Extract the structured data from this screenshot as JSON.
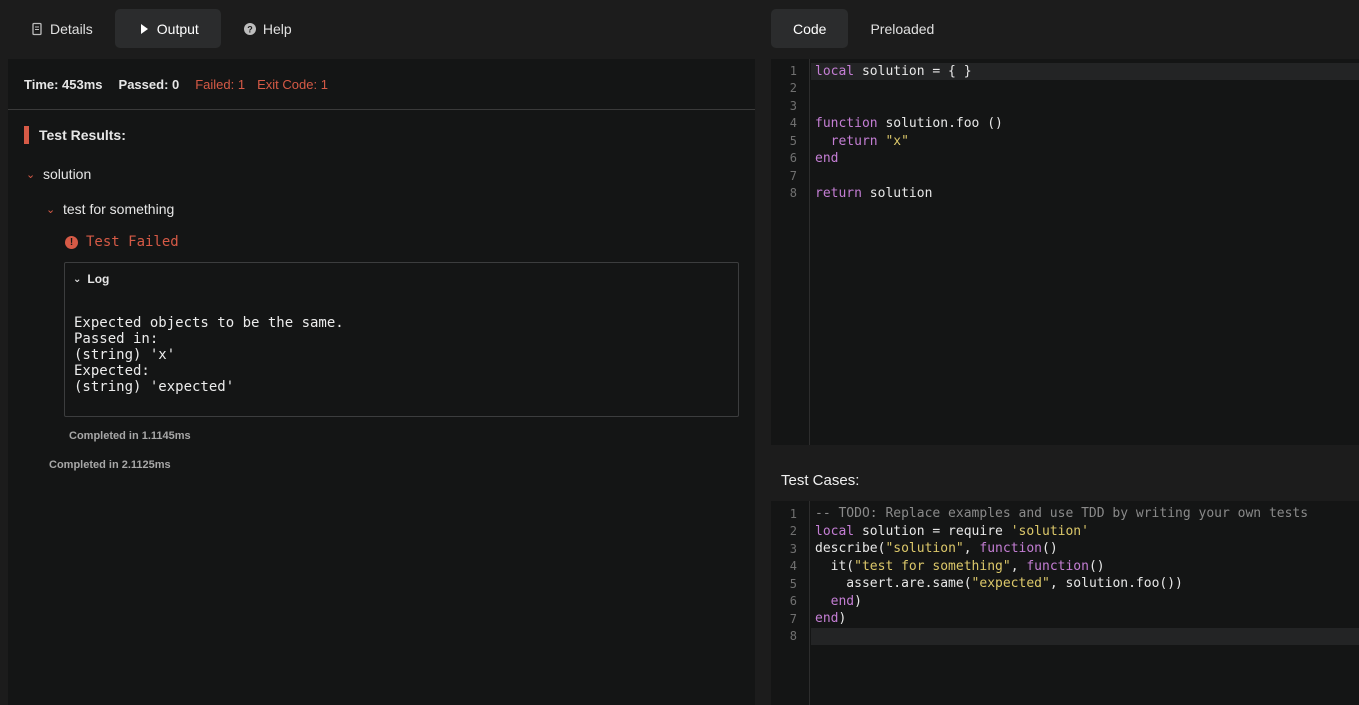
{
  "left_tabs": [
    {
      "label": "Details",
      "icon": "document-icon"
    },
    {
      "label": "Output",
      "icon": "play-icon"
    },
    {
      "label": "Help",
      "icon": "help-icon"
    }
  ],
  "stats": {
    "time": "Time: 453ms",
    "passed": "Passed: 0",
    "failed": "Failed: 1",
    "exit_code": "Exit Code: 1"
  },
  "results": {
    "title": "Test Results:",
    "suite": "solution",
    "test": "test for something",
    "status": "Test Failed",
    "log_label": "Log",
    "log_lines": [
      "Expected objects to be the same.",
      "Passed in:",
      "(string) 'x'",
      "Expected:",
      "(string) 'expected'"
    ],
    "test_completed": "Completed in 1.1145ms",
    "suite_completed": "Completed in 2.1125ms"
  },
  "right_tabs": [
    {
      "label": "Code"
    },
    {
      "label": "Preloaded"
    }
  ],
  "code_lines": [
    "local solution = { }",
    "",
    "",
    "function solution.foo ()",
    "  return \"x\"",
    "end",
    "",
    "return solution"
  ],
  "test_cases_title": "Test Cases:",
  "test_lines": [
    "-- TODO: Replace examples and use TDD by writing your own tests",
    "local solution = require 'solution'",
    "describe(\"solution\", function()",
    "  it(\"test for something\", function()",
    "    assert.are.same(\"expected\", solution.foo())",
    "  end)",
    "end)",
    ""
  ],
  "colors": {
    "accent_error": "#d65a46",
    "keyword": "#c47ed4",
    "string": "#dcc86a",
    "background": "#141515"
  }
}
